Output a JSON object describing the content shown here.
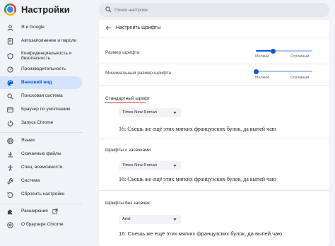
{
  "header": {
    "title": "Настройки",
    "search_placeholder": "Поиск настроек"
  },
  "sidebar": {
    "items": [
      {
        "label": "Я и Google",
        "icon": "person-icon"
      },
      {
        "label": "Автозаполнение и пароли",
        "icon": "document-icon"
      },
      {
        "label": "Конфиденциальность и безопасность",
        "icon": "shield-icon"
      },
      {
        "label": "Производительность",
        "icon": "speedometer-icon"
      },
      {
        "label": "Внешний вид",
        "icon": "palette-icon",
        "active": true
      },
      {
        "label": "Поисковая система",
        "icon": "search-icon"
      },
      {
        "label": "Браузер по умолчанию",
        "icon": "browser-icon"
      },
      {
        "label": "Запуск Chrome",
        "icon": "power-icon"
      },
      {
        "label": "Языки",
        "icon": "globe-icon"
      },
      {
        "label": "Скачанные файлы",
        "icon": "download-icon"
      },
      {
        "label": "Спец. возможности",
        "icon": "accessibility-icon"
      },
      {
        "label": "Система",
        "icon": "wrench-icon"
      },
      {
        "label": "Сбросить настройки",
        "icon": "reset-icon"
      },
      {
        "label": "Расширения",
        "icon": "puzzle-icon"
      },
      {
        "label": "О браузере Chrome",
        "icon": "chrome-icon"
      }
    ]
  },
  "panel": {
    "title": "Настроить шрифты",
    "font_size": {
      "label": "Размер шрифта",
      "min_label": "Мелкий",
      "max_label": "Огромный",
      "value_fraction": 0.3
    },
    "min_font_size": {
      "label": "Минимальный размер шрифта",
      "min_label": "Мелкий",
      "max_label": "Огромный",
      "value_fraction": 0.0
    },
    "standard_font": {
      "label": "Стандартный шрифт",
      "value": "Times New Roman",
      "preview": "16: Съешь же ещё этих мягких французских булок, да выпей чаю"
    },
    "serif_font": {
      "label": "Шрифты с засечками",
      "value": "Times New Roman",
      "preview": "16: Съешь же ещё этих мягких французских булок, да выпей чаю"
    },
    "sans_font": {
      "label": "Шрифты без засечек",
      "value": "Arial",
      "preview": "16: Съешь же ещё этих мягких французских булок, да выпей чаю"
    }
  },
  "colors": {
    "accent": "#0b57d0",
    "active_bg": "#d3e3fd",
    "highlight": "#d93025"
  }
}
